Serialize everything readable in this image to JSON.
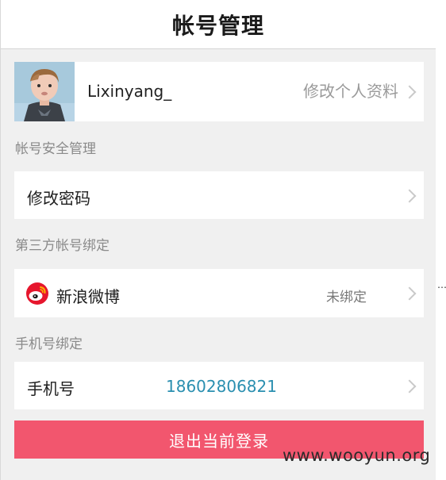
{
  "header": {
    "title": "帐号管理"
  },
  "profile": {
    "username": "Lixinyang_",
    "edit_label": "修改个人资料"
  },
  "sections": {
    "account_security": "帐号安全管理",
    "third_party": "第三方帐号绑定",
    "phone_binding": "手机号绑定"
  },
  "rows": {
    "change_password": "修改密码",
    "weibo_label": "新浪微博",
    "weibo_status": "未绑定",
    "phone_label": "手机号",
    "phone_number": "18602806821"
  },
  "logout_label": "退出当前登录",
  "watermark": "www.wooyun.org",
  "side_marker": "…",
  "icons": {
    "profile_chevron": "chevron-right-icon",
    "weibo": "weibo-logo-icon"
  },
  "colors": {
    "logout_button": "#f2566e",
    "phone_number": "#2a8fb0",
    "background": "#f0f0f0"
  }
}
